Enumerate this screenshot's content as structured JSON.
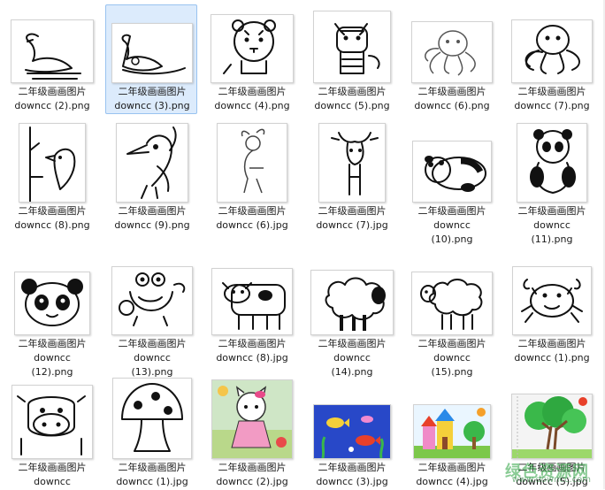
{
  "items": [
    {
      "title": "二年级画画图片",
      "file": "downcc (2).png",
      "pic": "swan",
      "selected": false
    },
    {
      "title": "二年级画画图片",
      "file": "downcc (3).png",
      "pic": "swan-lake",
      "selected": true
    },
    {
      "title": "二年级画画图片",
      "file": "downcc (4).png",
      "pic": "tiger-face",
      "selected": false
    },
    {
      "title": "二年级画画图片",
      "file": "downcc (5).png",
      "pic": "tiger",
      "selected": false
    },
    {
      "title": "二年级画画图片",
      "file": "downcc (6).png",
      "pic": "octopus",
      "selected": false
    },
    {
      "title": "二年级画画图片",
      "file": "downcc (7).png",
      "pic": "octopus-big",
      "selected": false
    },
    {
      "title": "二年级画画图片",
      "file": "downcc (8).png",
      "pic": "bird-branch",
      "selected": false
    },
    {
      "title": "二年级画画图片",
      "file": "downcc (9).png",
      "pic": "woodpecker",
      "selected": false
    },
    {
      "title": "二年级画画图片",
      "file": "downcc (6).jpg",
      "pic": "deer",
      "selected": false
    },
    {
      "title": "二年级画画图片",
      "file": "downcc (7).jpg",
      "pic": "moose",
      "selected": false
    },
    {
      "title": "二年级画画图片",
      "file": "downcc (10).png",
      "pic": "panda-lying",
      "selected": false
    },
    {
      "title": "二年级画画图片",
      "file": "downcc (11).png",
      "pic": "panda-sitting",
      "selected": false
    },
    {
      "title": "二年级画画图片",
      "file": "downcc (12).png",
      "pic": "panda-face",
      "selected": false
    },
    {
      "title": "二年级画画图片",
      "file": "downcc (13).png",
      "pic": "crab-cartoon",
      "selected": false
    },
    {
      "title": "二年级画画图片",
      "file": "downcc (8).jpg",
      "pic": "cow",
      "selected": false
    },
    {
      "title": "二年级画画图片",
      "file": "downcc (14).png",
      "pic": "sheep-black",
      "selected": false
    },
    {
      "title": "二年级画画图片",
      "file": "downcc (15).png",
      "pic": "sheep",
      "selected": false
    },
    {
      "title": "二年级画画图片",
      "file": "downcc (1).png",
      "pic": "crab",
      "selected": false
    },
    {
      "title": "二年级画画图片",
      "file": "downcc",
      "pic": "cow-face",
      "selected": false
    },
    {
      "title": "二年级画画图片",
      "file": "downcc (1).jpg",
      "pic": "mushroom",
      "selected": false
    },
    {
      "title": "二年级画画图片",
      "file": "downcc (2).jpg",
      "pic": "kitty-color",
      "selected": false
    },
    {
      "title": "二年级画画图片",
      "file": "downcc (3).jpg",
      "pic": "fish-color",
      "selected": false
    },
    {
      "title": "二年级画画图片",
      "file": "downcc (4).jpg",
      "pic": "castle-color",
      "selected": false
    },
    {
      "title": "二年级画画图片",
      "file": "downcc (5).jpg",
      "pic": "tree-color",
      "selected": false
    }
  ],
  "watermark": {
    "cn": "绿色资源网",
    "en": "www.downcc.com"
  },
  "colors": {
    "selection_bg": "#dcebfc",
    "selection_border": "#99c3f0",
    "text": "#1a1a1a"
  }
}
